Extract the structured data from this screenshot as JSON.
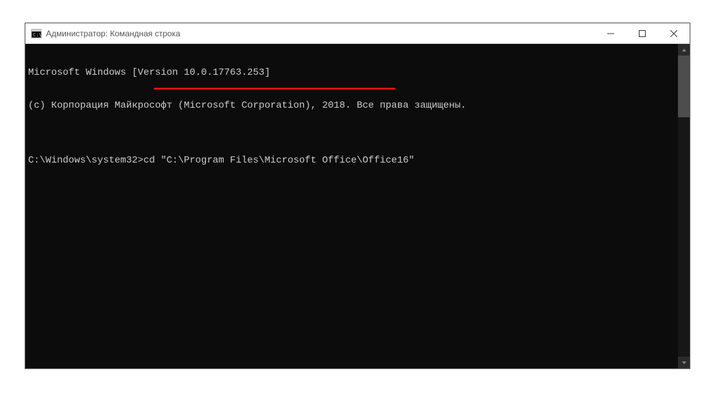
{
  "window": {
    "title": "Администратор: Командная строка"
  },
  "console": {
    "line1": "Microsoft Windows [Version 10.0.17763.253]",
    "line2": "(c) Корпорация Майкрософт (Microsoft Corporation), 2018. Все права защищены.",
    "blank": "",
    "prompt": "C:\\Windows\\system32>",
    "command": "cd \"C:\\Program Files\\Microsoft Office\\Office16\""
  },
  "controls": {
    "minimize": "—",
    "maximize": "☐",
    "close": "✕"
  }
}
